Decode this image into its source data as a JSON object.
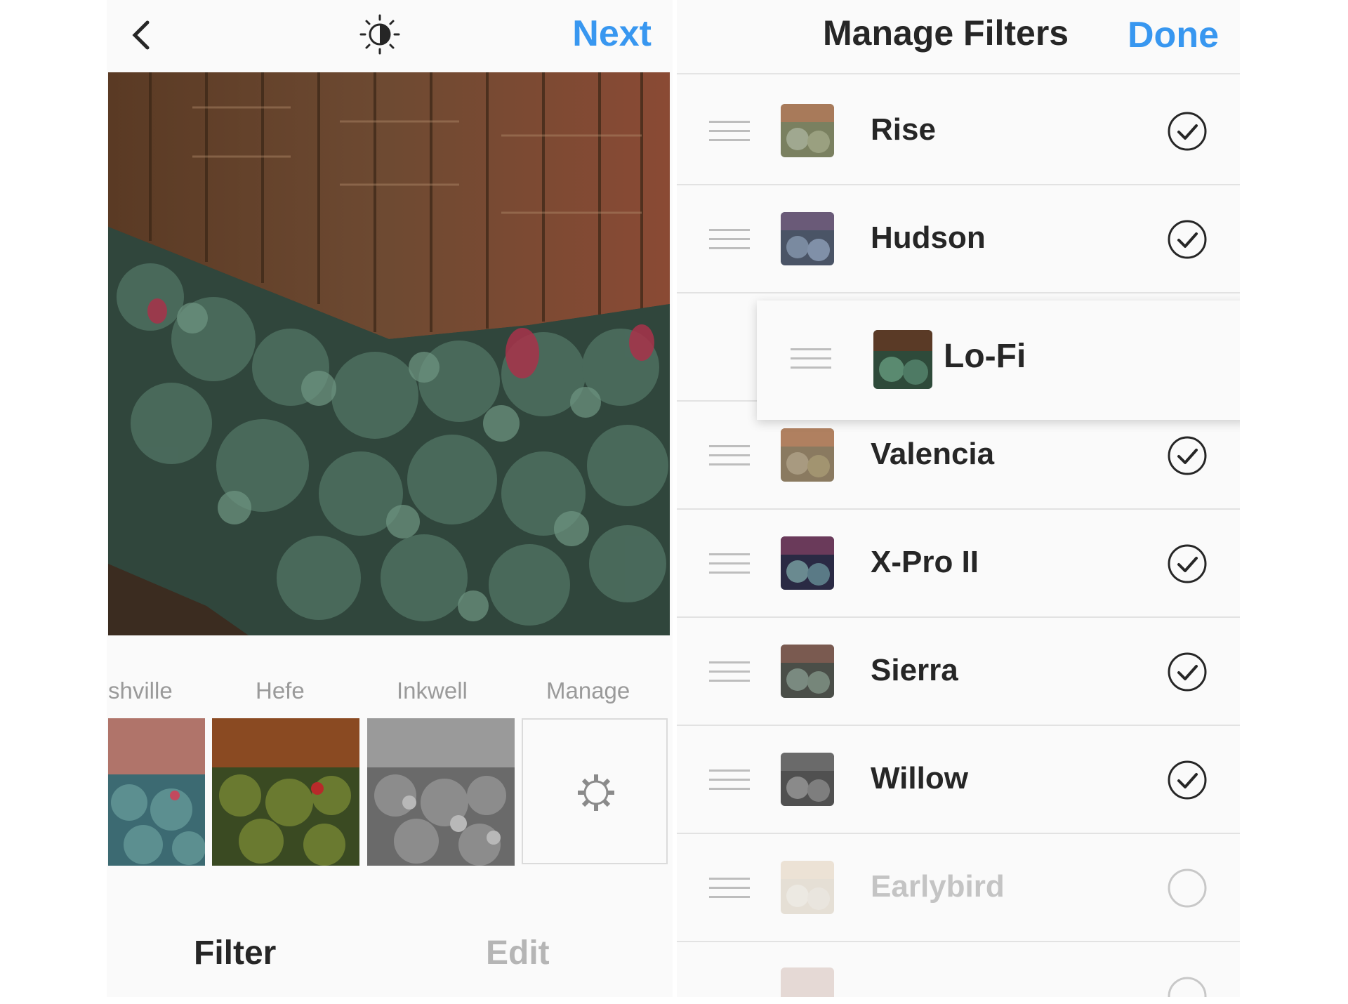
{
  "filter_screen": {
    "next_label": "Next",
    "filter_names": [
      "shville",
      "Hefe",
      "Inkwell",
      "Manage"
    ],
    "bottom_tabs": {
      "filter": "Filter",
      "edit": "Edit"
    },
    "active_tab": "filter",
    "icons": {
      "back": "back-chevron-icon",
      "lux": "lux-adjust-icon",
      "manage": "gear-icon"
    }
  },
  "manage_filters": {
    "title": "Manage Filters",
    "done_label": "Done",
    "dragging_item": "Lo-Fi",
    "items": [
      {
        "name": "Rise",
        "checked": true
      },
      {
        "name": "Hudson",
        "checked": true
      },
      {
        "name": "Valencia",
        "checked": true
      },
      {
        "name": "X-Pro II",
        "checked": true
      },
      {
        "name": "Sierra",
        "checked": true
      },
      {
        "name": "Willow",
        "checked": true
      },
      {
        "name": "Earlybird",
        "checked": false
      }
    ],
    "icons": {
      "drag": "drag-handle-icon",
      "check": "checkmark-circle-icon"
    }
  },
  "colors": {
    "accent": "#3897f0",
    "text": "#262626",
    "muted": "#9a9a9a"
  }
}
